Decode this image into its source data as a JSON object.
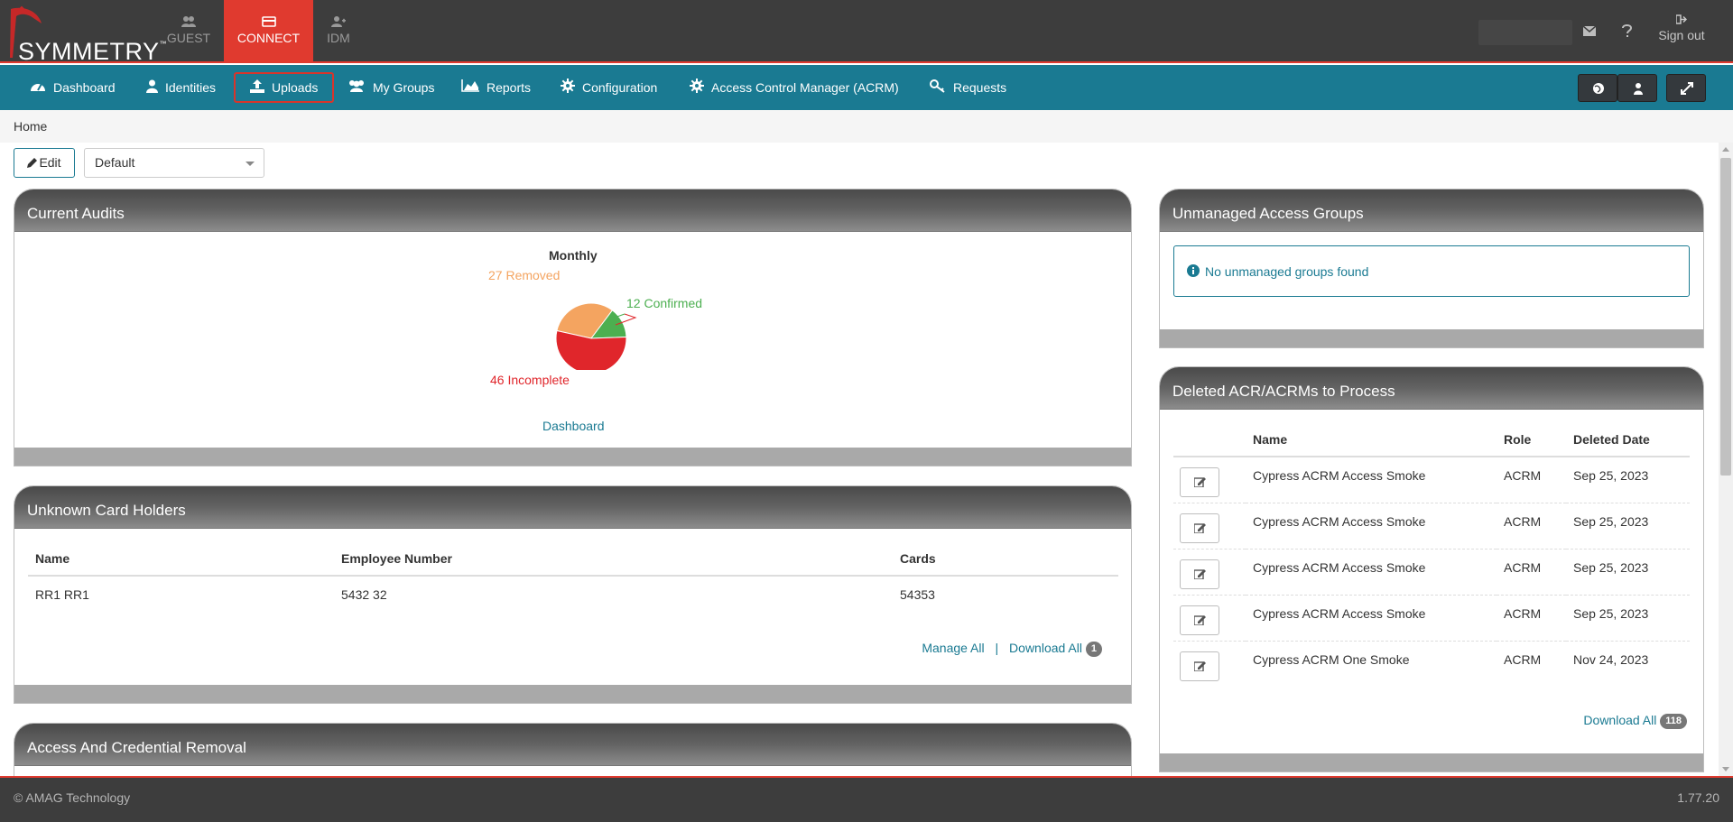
{
  "brand": {
    "name": "SYMMETRY",
    "tm": "™",
    "accent": "#e03a2f",
    "nav_color": "#1a7a92"
  },
  "modules": [
    {
      "label": "GUEST",
      "icon": "users-icon"
    },
    {
      "label": "CONNECT",
      "icon": "card-icon",
      "active": true
    },
    {
      "label": "IDM",
      "icon": "user-plus-icon"
    }
  ],
  "topright": {
    "signout_label": "Sign out"
  },
  "nav": {
    "items": [
      {
        "label": "Dashboard",
        "icon": "dashboard-icon"
      },
      {
        "label": "Identities",
        "icon": "user-icon"
      },
      {
        "label": "Uploads",
        "icon": "upload-icon",
        "highlighted": true
      },
      {
        "label": "My Groups",
        "icon": "users-icon"
      },
      {
        "label": "Reports",
        "icon": "area-chart-icon"
      },
      {
        "label": "Configuration",
        "icon": "gear-icon"
      },
      {
        "label": "Access Control Manager (ACRM)",
        "icon": "gear-icon"
      },
      {
        "label": "Requests",
        "icon": "key-icon"
      }
    ]
  },
  "breadcrumb": {
    "home": "Home"
  },
  "toolbar": {
    "edit_label": "Edit",
    "layout_select": "Default"
  },
  "current_audits": {
    "title": "Current Audits",
    "link": "Dashboard",
    "chart_data": {
      "type": "pie",
      "title": "Monthly",
      "slices": [
        {
          "label": "27 Removed",
          "value": 27,
          "color": "#f4a460"
        },
        {
          "label": "12 Confirmed",
          "value": 12,
          "color": "#4caf50"
        },
        {
          "label": "46 Incomplete",
          "value": 46,
          "color": "#e0262b"
        }
      ]
    }
  },
  "unknown_card_holders": {
    "title": "Unknown Card Holders",
    "columns": [
      "Name",
      "Employee Number",
      "Cards"
    ],
    "rows": [
      [
        "RR1 RR1",
        "5432 32",
        "54353"
      ]
    ],
    "manage_all": "Manage All",
    "separator": "|",
    "download_all": "Download All",
    "count": "1"
  },
  "access_credential_removal": {
    "title": "Access And Credential Removal"
  },
  "unmanaged_access_groups": {
    "title": "Unmanaged Access Groups",
    "message": "No unmanaged groups found"
  },
  "deleted_acrms": {
    "title": "Deleted ACR/ACRMs to Process",
    "columns": [
      "Name",
      "Role",
      "Deleted Date"
    ],
    "rows": [
      [
        "Cypress ACRM Access Smoke",
        "ACRM",
        "Sep 25, 2023"
      ],
      [
        "Cypress ACRM Access Smoke",
        "ACRM",
        "Sep 25, 2023"
      ],
      [
        "Cypress ACRM Access Smoke",
        "ACRM",
        "Sep 25, 2023"
      ],
      [
        "Cypress ACRM Access Smoke",
        "ACRM",
        "Sep 25, 2023"
      ],
      [
        "Cypress ACRM One Smoke",
        "ACRM",
        "Nov 24, 2023"
      ]
    ],
    "download_all": "Download All",
    "count": "118"
  },
  "footer": {
    "copyright": "© AMAG Technology",
    "version": "1.77.20"
  }
}
